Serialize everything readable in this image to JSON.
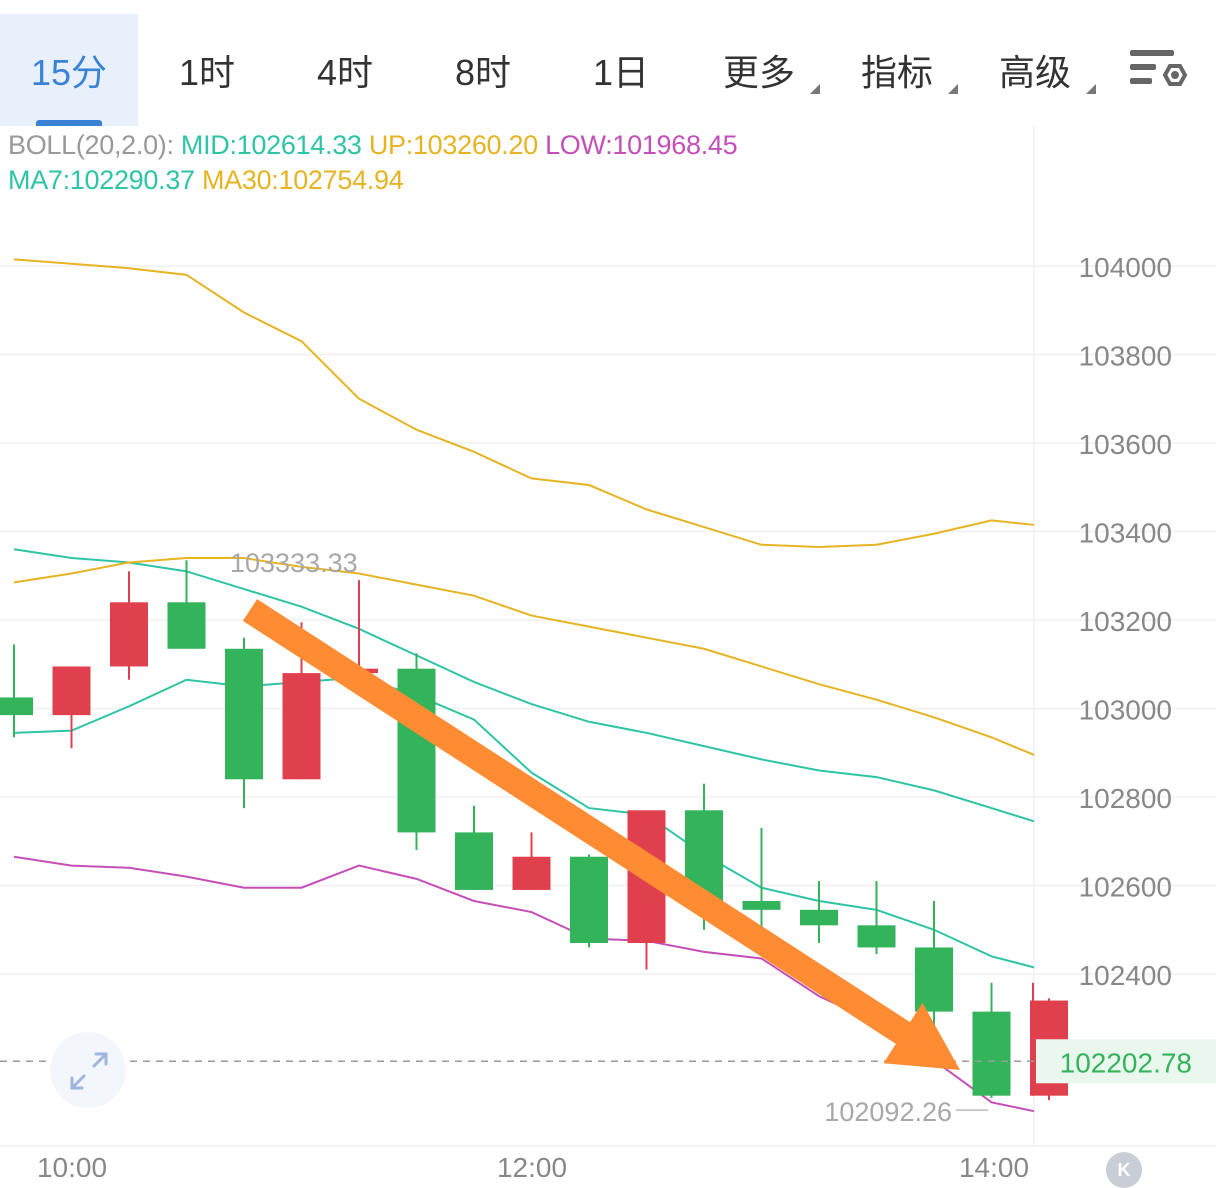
{
  "tabs": [
    {
      "label": "15分",
      "active": true,
      "dropdown": false
    },
    {
      "label": "1时",
      "active": false,
      "dropdown": false
    },
    {
      "label": "4时",
      "active": false,
      "dropdown": false
    },
    {
      "label": "8时",
      "active": false,
      "dropdown": false
    },
    {
      "label": "1日",
      "active": false,
      "dropdown": false
    },
    {
      "label": "更多",
      "active": false,
      "dropdown": true
    },
    {
      "label": "指标",
      "active": false,
      "dropdown": true
    },
    {
      "label": "高级",
      "active": false,
      "dropdown": true
    }
  ],
  "settings_icon": "chart-settings-icon",
  "legend": {
    "boll_label": "BOLL(20,2.0):",
    "mid": "MID:102614.33",
    "up": "UP:103260.20",
    "low": "LOW:101968.45",
    "ma7": "MA7:102290.37",
    "ma30": "MA30:102754.94"
  },
  "colors": {
    "up_candle": "#e0404d",
    "down_candle": "#33b35a",
    "mid": "#2ec4a6",
    "up": "#e6b422",
    "low": "#c54fb8",
    "ma7": "#2ec4a6",
    "ma30": "#e6b422",
    "arrow": "#ff8c32",
    "accent": "#3a82d6"
  },
  "chart_data": {
    "type": "candlestick",
    "y_ticks": [
      104000,
      103800,
      103600,
      103400,
      103200,
      103000,
      102800,
      102600,
      102400
    ],
    "ylim": [
      101990,
      104280
    ],
    "x_ticks": [
      "10:00",
      "12:00",
      "14:00"
    ],
    "current_price": "102202.78",
    "max_label": "103333.33",
    "min_label": "102092.26",
    "candles": [
      {
        "o": 103025,
        "h": 103145,
        "l": 102935,
        "c": 102985
      },
      {
        "o": 102985,
        "h": 103085,
        "l": 102910,
        "c": 103095
      },
      {
        "o": 103095,
        "h": 103310,
        "l": 103065,
        "c": 103240
      },
      {
        "o": 103240,
        "h": 103335,
        "l": 103145,
        "c": 103135
      },
      {
        "o": 103135,
        "h": 103160,
        "l": 102775,
        "c": 102840
      },
      {
        "o": 102840,
        "h": 103195,
        "l": 102840,
        "c": 103080
      },
      {
        "o": 103080,
        "h": 103290,
        "l": 103070,
        "c": 103090
      },
      {
        "o": 103090,
        "h": 103125,
        "l": 102680,
        "c": 102720
      },
      {
        "o": 102720,
        "h": 102780,
        "l": 102590,
        "c": 102590
      },
      {
        "o": 102590,
        "h": 102720,
        "l": 102590,
        "c": 102665
      },
      {
        "o": 102665,
        "h": 102670,
        "l": 102460,
        "c": 102470
      },
      {
        "o": 102470,
        "h": 102760,
        "l": 102410,
        "c": 102770
      },
      {
        "o": 102770,
        "h": 102830,
        "l": 102500,
        "c": 102565
      },
      {
        "o": 102565,
        "h": 102730,
        "l": 102500,
        "c": 102545
      },
      {
        "o": 102545,
        "h": 102610,
        "l": 102470,
        "c": 102510
      },
      {
        "o": 102510,
        "h": 102610,
        "l": 102445,
        "c": 102460
      },
      {
        "o": 102460,
        "h": 102565,
        "l": 102270,
        "c": 102315
      },
      {
        "o": 102315,
        "h": 102380,
        "l": 102120,
        "c": 102125
      },
      {
        "o": 102125,
        "h": 102345,
        "l": 102115,
        "c": 102340
      }
    ],
    "series": [
      {
        "name": "UP",
        "values": [
          104015,
          104005,
          103995,
          103980,
          103895,
          103830,
          103700,
          103630,
          103580,
          103520,
          103505,
          103450,
          103410,
          103370,
          103365,
          103370,
          103395,
          103425,
          103415
        ]
      },
      {
        "name": "MID",
        "values": [
          103360,
          103340,
          103330,
          103310,
          103270,
          103230,
          103180,
          103120,
          103060,
          103010,
          102970,
          102945,
          102915,
          102885,
          102860,
          102845,
          102815,
          102775,
          102745
        ]
      },
      {
        "name": "LOW",
        "values": [
          102665,
          102645,
          102640,
          102620,
          102595,
          102595,
          102645,
          102615,
          102565,
          102540,
          102480,
          102475,
          102450,
          102435,
          102350,
          102290,
          102205,
          102110,
          102090
        ]
      },
      {
        "name": "MA30",
        "values": [
          103285,
          103305,
          103330,
          103340,
          103340,
          103320,
          103305,
          103280,
          103255,
          103210,
          103185,
          103160,
          103135,
          103095,
          103055,
          103020,
          102980,
          102935,
          102895
        ]
      },
      {
        "name": "MA7",
        "values": [
          102945,
          102950,
          103005,
          103065,
          103050,
          103060,
          103070,
          103030,
          102975,
          102855,
          102775,
          102760,
          102670,
          102595,
          102565,
          102545,
          102500,
          102440,
          102415
        ]
      }
    ]
  }
}
